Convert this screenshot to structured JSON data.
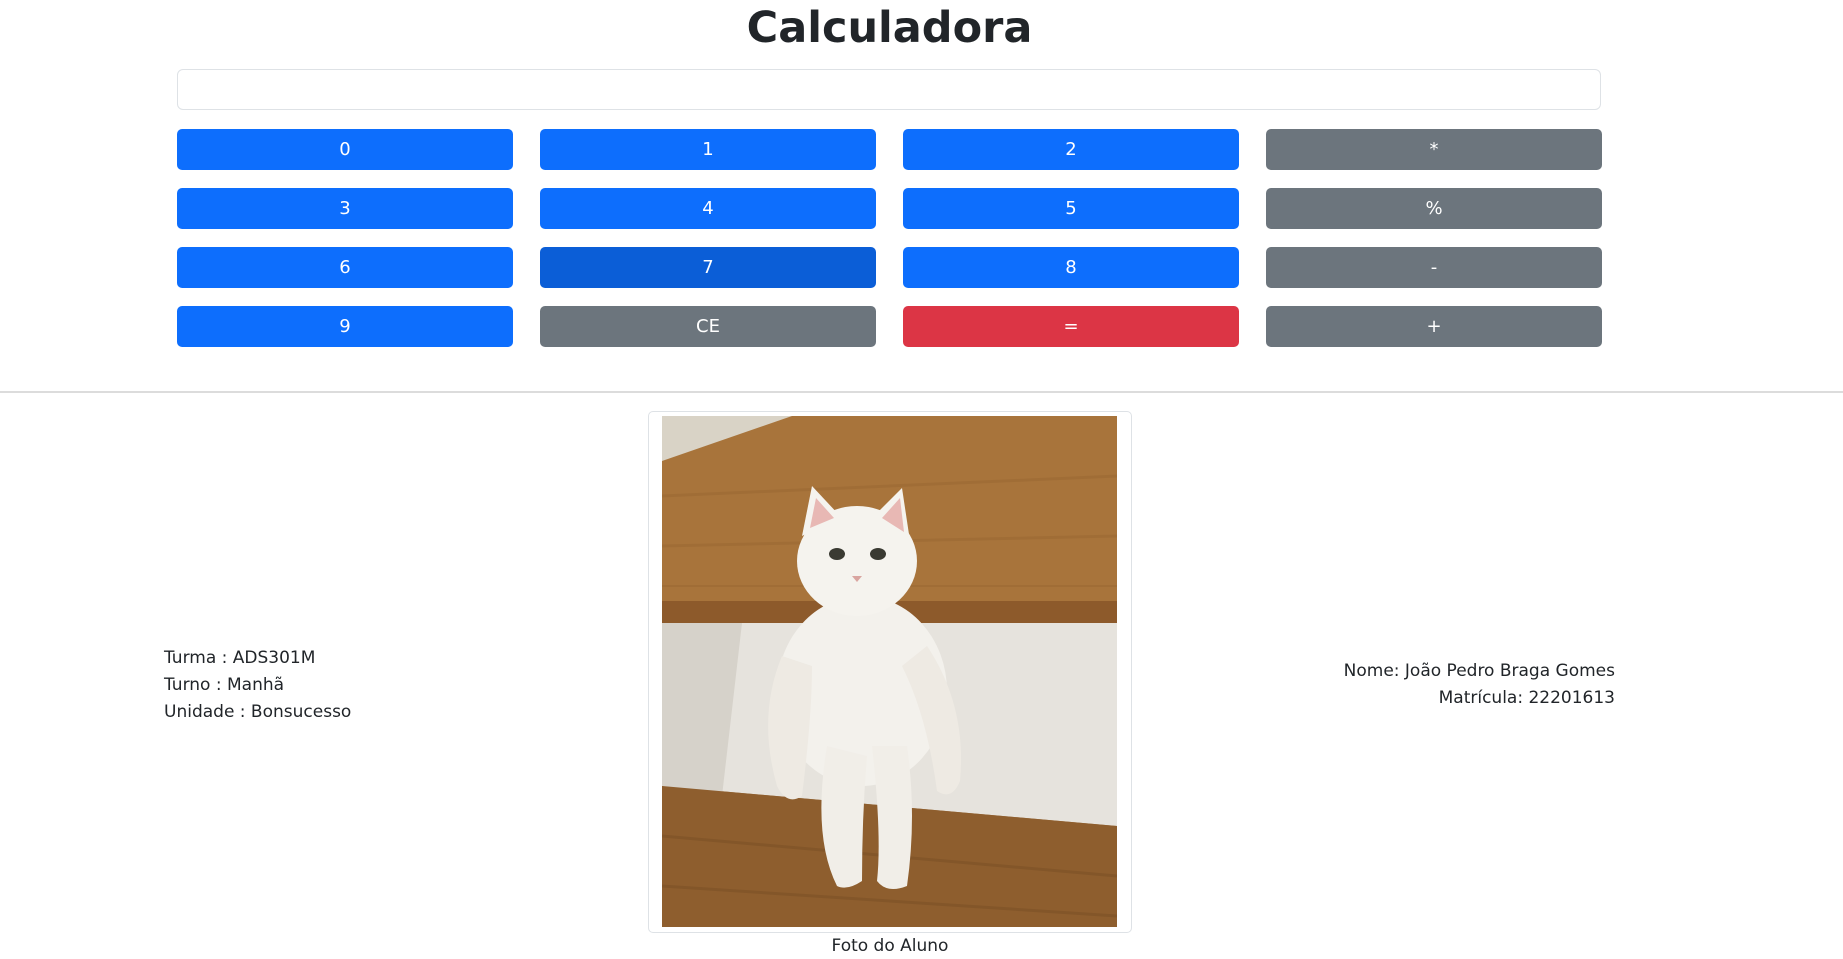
{
  "header": {
    "title": "Calculadora"
  },
  "display": {
    "value": "",
    "placeholder": ""
  },
  "keypad": {
    "keys": [
      {
        "label": "0",
        "variant": "primary"
      },
      {
        "label": "1",
        "variant": "primary"
      },
      {
        "label": "2",
        "variant": "primary"
      },
      {
        "label": "*",
        "variant": "secondary"
      },
      {
        "label": "3",
        "variant": "primary"
      },
      {
        "label": "4",
        "variant": "primary"
      },
      {
        "label": "5",
        "variant": "primary"
      },
      {
        "label": "%",
        "variant": "secondary"
      },
      {
        "label": "6",
        "variant": "primary"
      },
      {
        "label": "7",
        "variant": "primary",
        "state": "hover"
      },
      {
        "label": "8",
        "variant": "primary"
      },
      {
        "label": "-",
        "variant": "secondary"
      },
      {
        "label": "9",
        "variant": "primary"
      },
      {
        "label": "CE",
        "variant": "secondary"
      },
      {
        "label": "=",
        "variant": "danger"
      },
      {
        "label": "+",
        "variant": "secondary"
      }
    ]
  },
  "student_left": {
    "turma": "Turma : ADS301M",
    "turno": "Turno : Manhã",
    "unidade": "Unidade : Bonsucesso"
  },
  "student_right": {
    "nome": "Nome: João Pedro Braga Gomes",
    "matricula": "Matrícula: 22201613"
  },
  "photo": {
    "caption": "Foto do Aluno",
    "icon": "cat-photo"
  },
  "colors": {
    "primary": "#0d6efd",
    "primary_hover": "#0b5ed7",
    "secondary": "#6c757d",
    "danger": "#dc3545",
    "text": "#212529"
  }
}
